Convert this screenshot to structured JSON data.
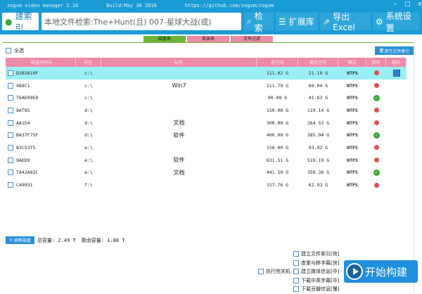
{
  "title": {
    "app": "zogvm video manager 2.10",
    "build": "Build:May 30 2016",
    "url": "https://github.com/zogvm/zogvm"
  },
  "toolbar": {
    "build_index": "建索引",
    "search_value": "本地文件检索:The+Hunt(且) 007-星球大战(或)",
    "search": "检索",
    "extension": "扩展库",
    "export": "导出Excel",
    "settings": "系统设置"
  },
  "tabs": [
    {
      "label": "磁盘表",
      "color": "#6cb43a"
    },
    {
      "label": "目录表",
      "color": "#ec8ba8"
    },
    {
      "label": "文件过滤",
      "color": "#ec8ba8"
    }
  ],
  "select_all": "全选",
  "clear_index": "清空文件索引",
  "columns": [
    "磁盘序列号",
    "分区",
    "标签",
    "总空间",
    "剩余空间",
    "格式",
    "接驳",
    "删除"
  ],
  "rows": [
    {
      "serial": "D2B3A10F",
      "part": "c:\\",
      "tag": "",
      "total": "111.02 G",
      "free": "21.19 G",
      "fmt": "NTFS",
      "status": "red"
    },
    {
      "serial": "988C1",
      "part": "c:\\",
      "tag": "Win7",
      "total": "111.79 G",
      "free": "60.04 G",
      "fmt": "NTFS",
      "status": "red"
    },
    {
      "serial": "T6AE09E8",
      "part": "c:\\",
      "tag": "",
      "total": "90.00 G",
      "free": "41.83 G",
      "fmt": "NTFS",
      "status": "green"
    },
    {
      "serial": "8AT85",
      "part": "d:\\",
      "tag": "",
      "total": "150.00 G",
      "free": "119.14 G",
      "fmt": "NTFS",
      "status": "red"
    },
    {
      "serial": "AA154",
      "part": "d:\\",
      "tag": "文档",
      "total": "300.00 G",
      "free": "264.53 G",
      "fmt": "NTFS",
      "status": "red"
    },
    {
      "serial": "BA37F75F",
      "part": "d:\\",
      "tag": "软件",
      "total": "400.00 G",
      "free": "385.94 G",
      "fmt": "NTFS",
      "status": "green"
    },
    {
      "serial": "83C53T5",
      "part": "e:\\",
      "tag": "",
      "total": "158.00 G",
      "free": "93.92 G",
      "fmt": "NTFS",
      "status": "red"
    },
    {
      "serial": "9AED9",
      "part": "e:\\",
      "tag": "软件",
      "total": "631.51 G",
      "free": "519.19 G",
      "fmt": "NTFS",
      "status": "red"
    },
    {
      "serial": "TA42A82C",
      "part": "e:\\",
      "tag": "文档",
      "total": "441.50 G",
      "free": "359.38 G",
      "fmt": "NTFS",
      "status": "green"
    },
    {
      "serial": "C49931",
      "part": "f:\\",
      "tag": "",
      "total": "157.76 G",
      "free": "62.93 G",
      "fmt": "NTFS",
      "status": "red"
    }
  ],
  "footer": {
    "refresh": "刷新磁盘",
    "total": "总容量: 2.49 T",
    "free": "剩余容量: 1.88 T"
  },
  "options": [
    "建立文件索引[快]",
    "查重与移字幕[快]",
    "建立媒体信息[中]",
    "下载中英字幕[中]",
    "下载豆瓣信息[慢]"
  ],
  "shutdown": "执行完关机",
  "start": "开始构建"
}
